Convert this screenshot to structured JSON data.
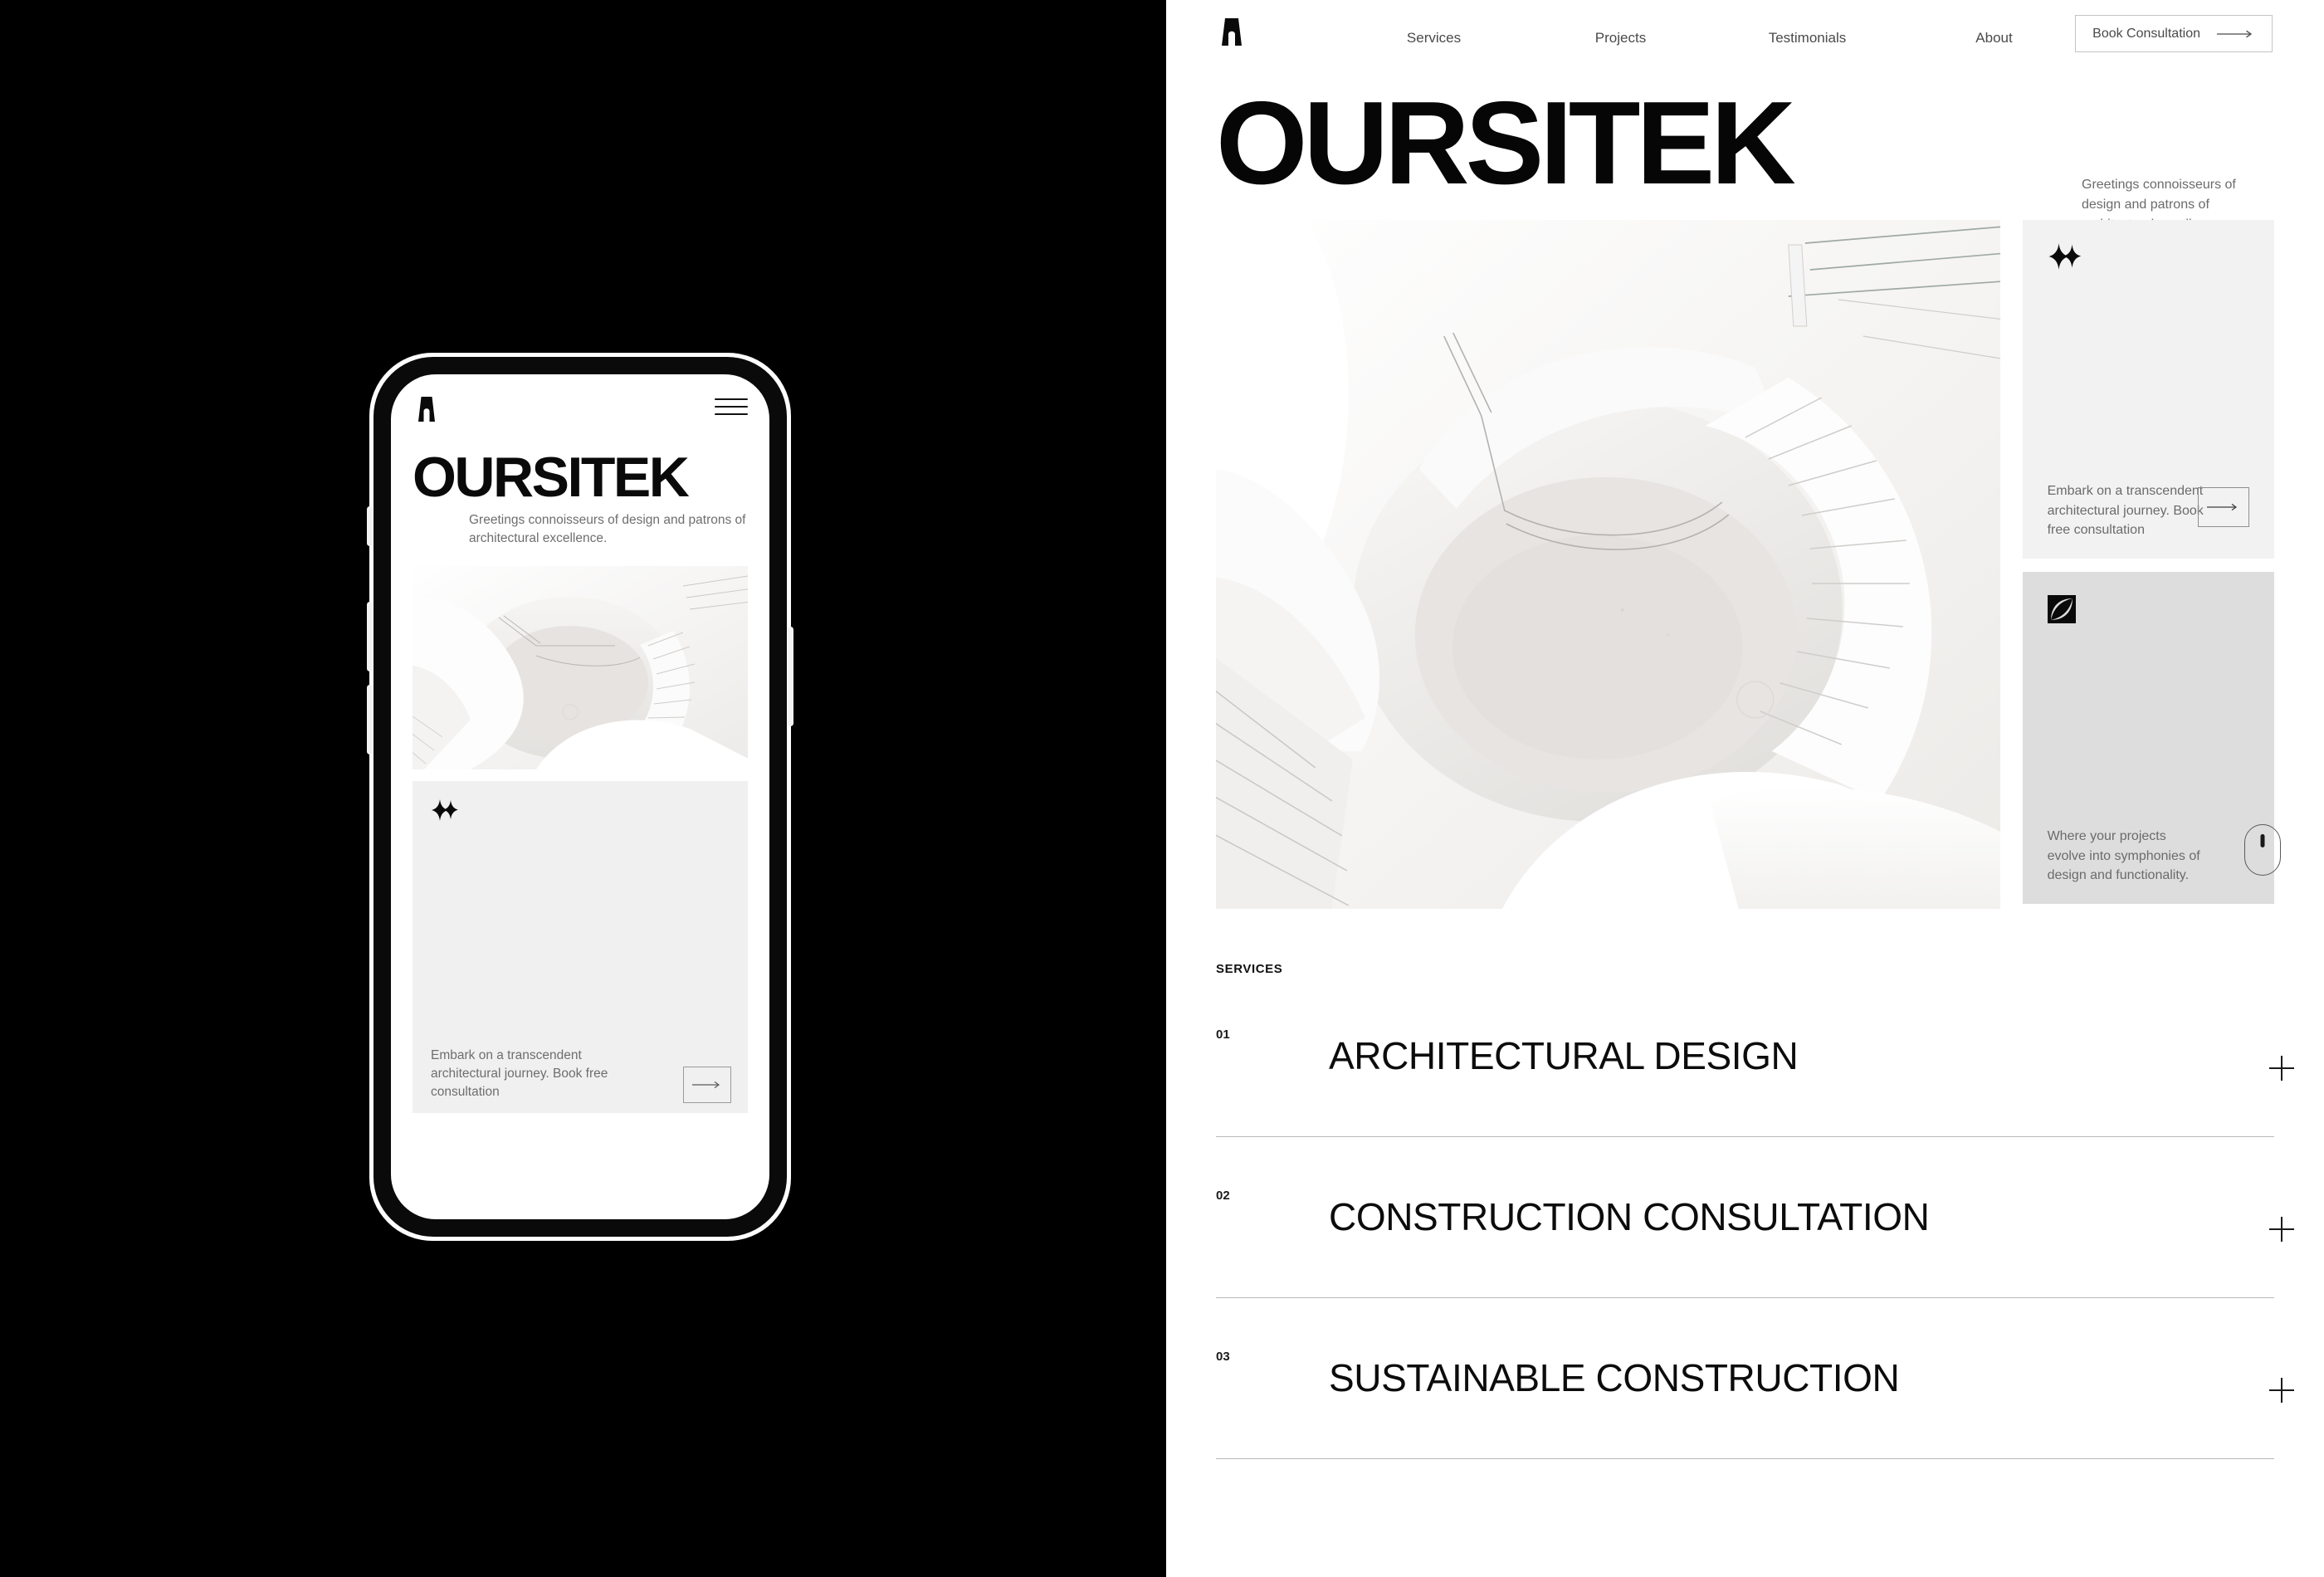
{
  "brand": {
    "name": "OURSITEK",
    "logo_icon": "arch-logo-icon"
  },
  "nav": {
    "links": [
      {
        "label": "Services"
      },
      {
        "label": "Projects"
      },
      {
        "label": "Testimonials"
      },
      {
        "label": "About"
      }
    ],
    "cta": {
      "label": "Book Consultation",
      "icon": "arrow-right-icon"
    }
  },
  "hero": {
    "title": "OURSITEK",
    "tagline": "Greetings connoisseurs of design and patrons of architectural excellence.",
    "image_alt": "white spiral staircase from above"
  },
  "cards": [
    {
      "icon": "double-sparkle-icon",
      "text": "Embark on a transcendent architectural journey. Book free consultation",
      "action_icon": "arrow-right-icon",
      "bg": "#f2f2f2"
    },
    {
      "icon": "square-lens-icon",
      "text": "Where your projects evolve into symphonies of design and functionality.",
      "action_icon": "mouse-scroll-icon",
      "bg": "#dddddd"
    }
  ],
  "services": {
    "label": "SERVICES",
    "items": [
      {
        "number": "01",
        "name": "ARCHITECTURAL DESIGN",
        "toggle_icon": "plus-icon"
      },
      {
        "number": "02",
        "name": "CONSTRUCTION CONSULTATION",
        "toggle_icon": "plus-icon"
      },
      {
        "number": "03",
        "name": "SUSTAINABLE CONSTRUCTION",
        "toggle_icon": "plus-icon"
      }
    ]
  },
  "mobile": {
    "menu_icon": "hamburger-menu-icon",
    "title": "OURSITEK",
    "tagline": "Greetings connoisseurs of design and patrons of architectural excellence.",
    "card": {
      "icon": "double-sparkle-icon",
      "text": "Embark on a transcendent architectural journey. Book free consultation",
      "action_icon": "arrow-right-icon"
    }
  },
  "colors": {
    "background_dark": "#000000",
    "background_light": "#ffffff",
    "card_light": "#f2f2f2",
    "card_dark": "#dddddd",
    "text_primary": "#0a0a0a",
    "text_muted": "#6b6b6b"
  }
}
